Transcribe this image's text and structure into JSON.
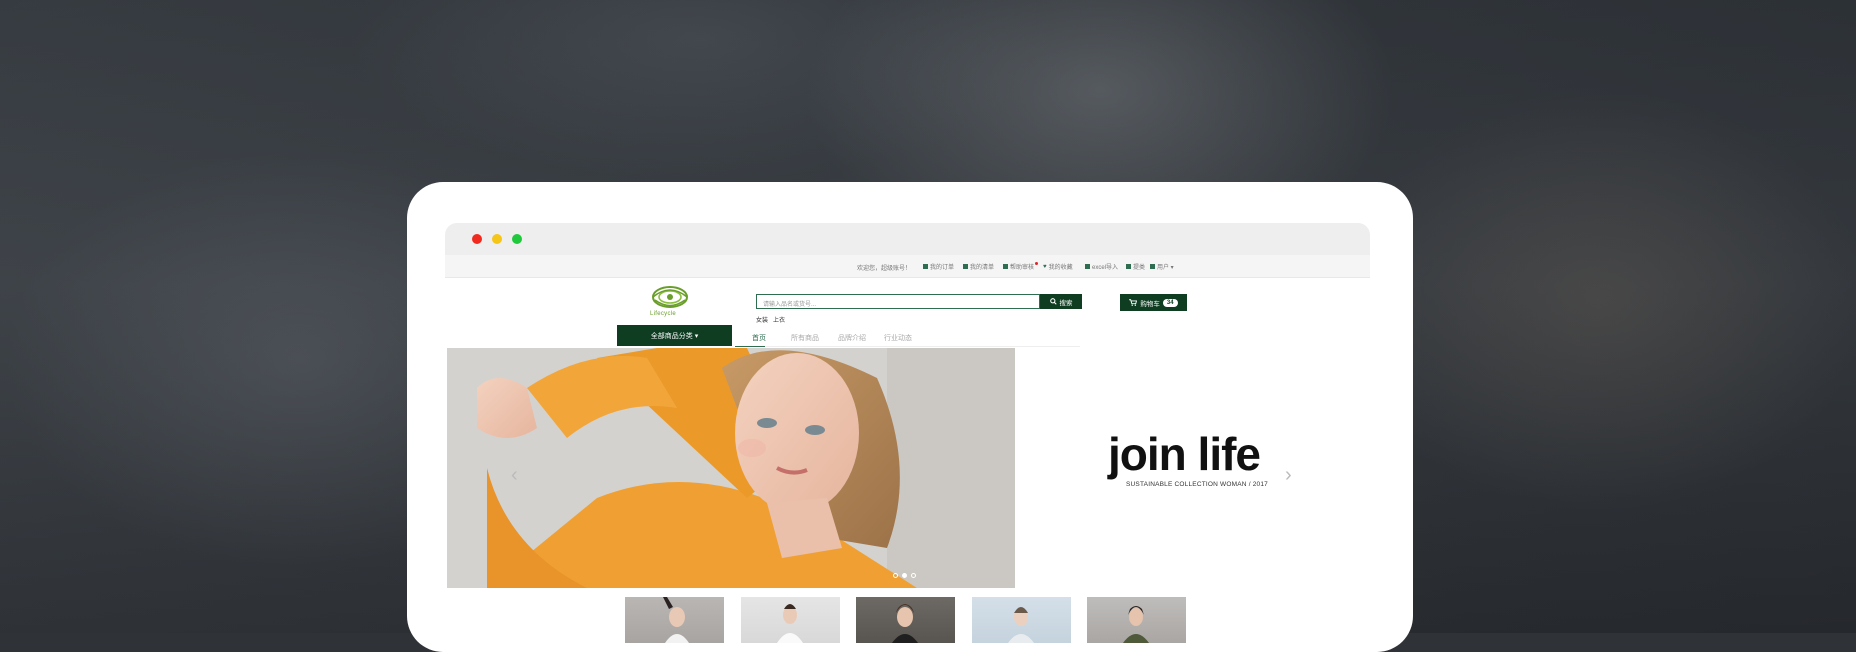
{
  "topbar": {
    "welcome": "欢迎您，超级账号！",
    "links": [
      "我的订单",
      "我的清单",
      "帮助审核",
      "我的收藏",
      "excel导入",
      "提类",
      "用户 ▾"
    ]
  },
  "logo": {
    "text": "Lifecycle"
  },
  "search": {
    "placeholder": "请输入品名或货号...",
    "button": "搜索",
    "hot_words": [
      "女装",
      "上衣"
    ]
  },
  "cart": {
    "label": "购物车",
    "count": "34"
  },
  "nav": {
    "category_button": "全部商品分类 ▾",
    "items": [
      "首页",
      "所有商品",
      "品牌介绍",
      "行业动态"
    ]
  },
  "hero": {
    "title": "join life",
    "subtitle": "SUSTAINABLE COLLECTION WOMAN / 2017",
    "prev": "‹",
    "next": "›",
    "active_slide": 2,
    "slide_count": 3
  },
  "colors": {
    "brand_green": "#0e3d22",
    "accent_green": "#2e6d4f",
    "sweater_orange": "#f0a032"
  }
}
